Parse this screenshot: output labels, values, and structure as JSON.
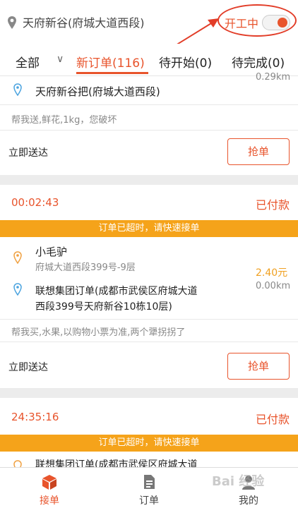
{
  "header": {
    "location": "天府新谷(府城大道西段)",
    "work_status": "开工中",
    "toggle_on": true,
    "accent_color": "#e8542c"
  },
  "tabs": {
    "all": "全部",
    "new_orders": "新订单(116)",
    "pending_start": "待开始(0)",
    "pending_done": "待完成(0)"
  },
  "orders": [
    {
      "distance_top": "0.29km",
      "dest_name": "天府新谷把(府城大道西段)",
      "note": "帮我送,鲜花,1kg，您破坏",
      "delivery": "立即送达",
      "grab": "抢单"
    },
    {
      "timer": "00:02:43",
      "status": "已付款",
      "banner": "订单已超时，请快速接单",
      "pickup_name": "小毛驴",
      "pickup_addr": "府城大道西段399号-9层",
      "price": "2.40元",
      "dest_line1": "联想集团订单(成都市武侯区府城大道",
      "dest_line2": "西段399号天府新谷10栋10层)",
      "distance": "0.00km",
      "note": "帮我买,水果,以购物小票为准,两个犟拐拐了",
      "delivery": "立即送达",
      "grab": "抢单"
    },
    {
      "timer": "24:35:16",
      "status": "已付款",
      "banner": "订单已超时，请快速接单",
      "dest_line1": "联想集团订单(成都市武侯区府城大道"
    }
  ],
  "nav": {
    "grab": "接单",
    "orders": "订单",
    "mine": "我的",
    "active_color": "#e8542c"
  },
  "watermark": "Bai 经验"
}
